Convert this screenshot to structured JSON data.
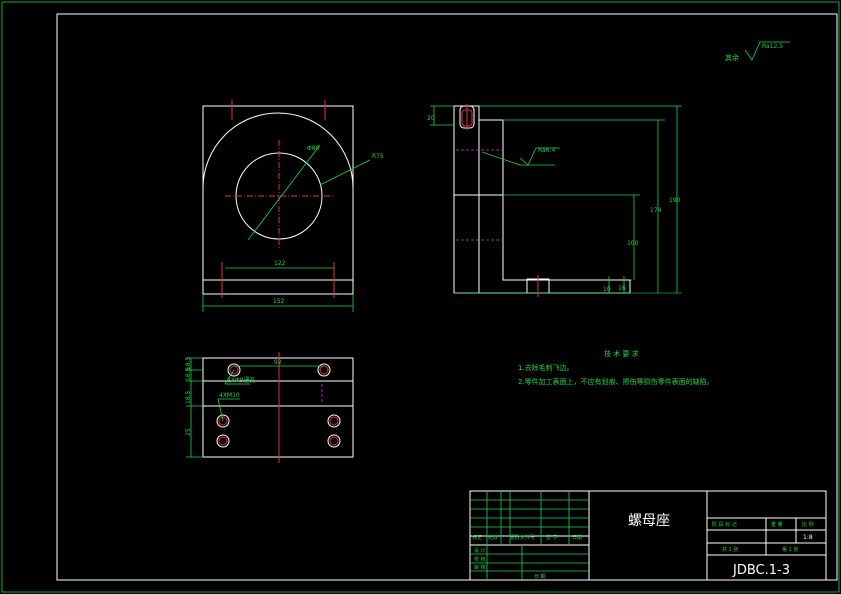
{
  "roughness_all": "其余",
  "roughness_all_value": "Ra12.5",
  "roughness_face_value": "Ra6.4",
  "dims": {
    "front_diameter": "Φ80",
    "front_radius": "R75",
    "front_width_inner": "122",
    "front_width_total": "152",
    "side_h_top": "20",
    "side_h_174": "174",
    "side_h_190": "190",
    "side_h_100": "100",
    "side_h_16": "16",
    "side_h_10": "10",
    "plan_hole_spacing": "92",
    "plan_hole_label1": "2XΦ9通孔",
    "plan_hole_label2": "4XM10",
    "plan_v1": "18.5",
    "plan_v2": "18.5",
    "plan_v3": "18.5",
    "plan_v4": "25"
  },
  "tech": {
    "title": "技 术 要 求",
    "items": [
      "1.去除毛刺飞边。",
      "2.零件加工表面上，不应有划痕、擦伤等损伤零件表面的缺陷。"
    ]
  },
  "title_block": {
    "part_name": "螺母座",
    "drawing_no": "JDBC.1-3",
    "scale": "1:8",
    "sheet_total": "共 1 张",
    "sheet_no": "第 1 张",
    "col_stage": "阶 段 标 记",
    "col_weight": "重 量",
    "col_scale": "比 例",
    "row_mark": "标记",
    "row_count": "处数",
    "row_zone": "更改文件号",
    "row_sign": "签 字",
    "row_date": "日期",
    "designer": "设 计",
    "checker": "校 核",
    "reviewer": "审 核",
    "date_label": "日 期"
  }
}
